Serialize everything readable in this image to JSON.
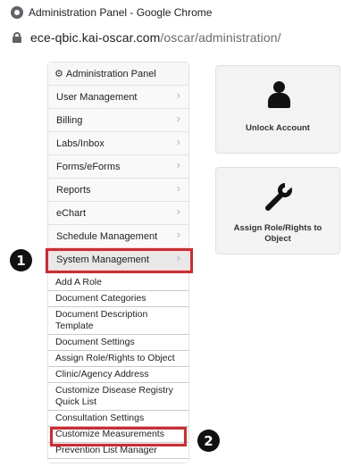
{
  "browser": {
    "window_title": "Administration Panel - Google Chrome",
    "url_host": "ece-qbic.kai-oscar.com",
    "url_path": "/oscar/administration/"
  },
  "sidebar": {
    "header": "Administration Panel",
    "items": [
      {
        "label": "User Management"
      },
      {
        "label": "Billing"
      },
      {
        "label": "Labs/Inbox"
      },
      {
        "label": "Forms/eForms"
      },
      {
        "label": "Reports"
      },
      {
        "label": "eChart"
      },
      {
        "label": "Schedule Management"
      },
      {
        "label": "System Management"
      }
    ],
    "submenu": [
      "Add A Role",
      "Document Categories",
      "Document Description Template",
      "Document Settings",
      "Assign Role/Rights to Object",
      "Clinic/Agency Address",
      "Customize Disease Registry Quick List",
      "Consultation Settings",
      "Customize Measurements",
      "Prevention List Manager"
    ]
  },
  "cards": {
    "unlock": "Unlock Account",
    "assign": "Assign Role/Rights to Object"
  },
  "steps": {
    "one": "1",
    "two": "2"
  },
  "colors": {
    "highlight": "#e2232a",
    "step_badge": "#111111"
  }
}
